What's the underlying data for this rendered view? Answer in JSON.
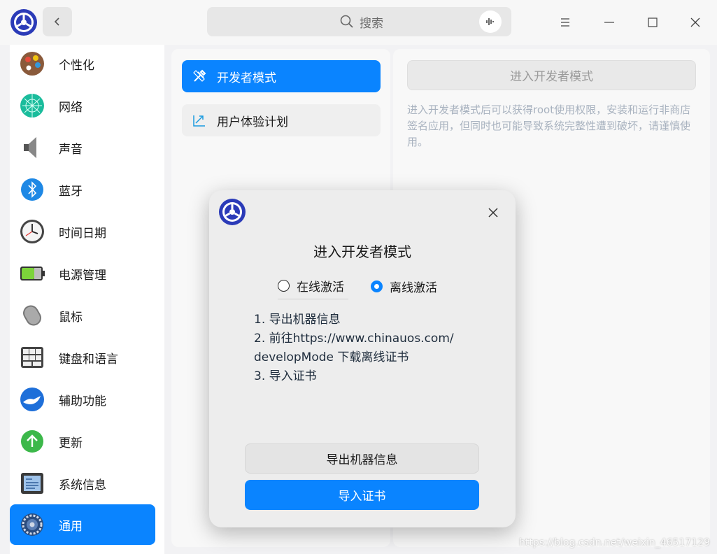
{
  "titlebar": {
    "search_placeholder": "搜索"
  },
  "sidebar": {
    "items": [
      {
        "label": "个性化",
        "icon": "personalization-icon"
      },
      {
        "label": "网络",
        "icon": "network-icon"
      },
      {
        "label": "声音",
        "icon": "sound-icon"
      },
      {
        "label": "蓝牙",
        "icon": "bluetooth-icon"
      },
      {
        "label": "时间日期",
        "icon": "clock-icon"
      },
      {
        "label": "电源管理",
        "icon": "battery-icon"
      },
      {
        "label": "鼠标",
        "icon": "mouse-icon"
      },
      {
        "label": "键盘和语言",
        "icon": "keyboard-icon"
      },
      {
        "label": "辅助功能",
        "icon": "accessibility-icon"
      },
      {
        "label": "更新",
        "icon": "update-icon"
      },
      {
        "label": "系统信息",
        "icon": "system-info-icon"
      },
      {
        "label": "通用",
        "icon": "general-icon"
      }
    ],
    "active_index": 11
  },
  "middle": {
    "items": [
      {
        "label": "开发者模式",
        "icon": "tools-icon"
      },
      {
        "label": "用户体验计划",
        "icon": "trend-icon"
      }
    ]
  },
  "right": {
    "enter_button": "进入开发者模式",
    "description": "进入开发者模式后可以获得root使用权限，安装和运行非商店签名应用，但同时也可能导致系统完整性遭到破坏，请谨慎使用。"
  },
  "dialog": {
    "title": "进入开发者模式",
    "radio_online": "在线激活",
    "radio_offline": "离线激活",
    "selected": "offline",
    "steps": {
      "s1": "1. 导出机器信息",
      "s2a": "2. 前往https://www.chinauos.com/",
      "s2b": "developMode 下载离线证书",
      "s3": "3. 导入证书"
    },
    "export_button": "导出机器信息",
    "import_button": "导入证书"
  },
  "watermark": "https://blog.csdn.net/weixin_46517129",
  "colors": {
    "accent": "#0a84ff"
  }
}
